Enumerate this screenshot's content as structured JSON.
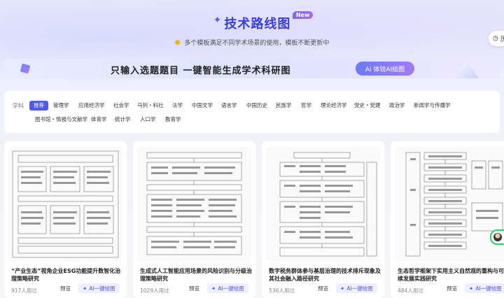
{
  "header": {
    "title": "技术路线图",
    "badge": "New",
    "subtitle": "多个模板满足不同学术场景的使用，模板不断更新中",
    "history_label": "历"
  },
  "banner": {
    "slogan": "只输入选题题目 一键智能生成学术科研图",
    "cta": "Ai 体验AI绘图"
  },
  "filters": {
    "label": "学科",
    "tags": [
      "推荐",
      "管理学",
      "应用经济学",
      "社会学",
      "马列・科社",
      "法学",
      "中国文学",
      "语言学",
      "中国历史",
      "民族学",
      "哲学",
      "理论经济学",
      "党史・党建",
      "政治学",
      "新闻学与传播学",
      "图书馆・情报与文献学",
      "体育学",
      "统计学",
      "人口学",
      "教育学"
    ],
    "active": "推荐"
  },
  "cards": [
    {
      "title": "“产业生态”视角企业ESG功能提升数智化治理策略研究",
      "users": "917人用过",
      "preview": "预览",
      "ai": "AI一键绘图"
    },
    {
      "title": "生成式人工智能应用场景的风险识别与分级治理策略研究",
      "users": "1029人用过",
      "preview": "预览",
      "ai": "AI一键绘图"
    },
    {
      "title": "数字税务群体参与基层治理的技术排斥现象及其社会融入路径研究",
      "users": "536人用过",
      "preview": "预览",
      "ai": "AI一键绘图"
    },
    {
      "title": "生态哲学框架下实用主义自然观的重构与可持续发展实践研究",
      "users": "484人用过",
      "preview": "预览",
      "ai": "AI一键绘图"
    }
  ],
  "colors": {
    "accent": "#4f58ef",
    "title": "#3a3fd6",
    "green": "#2ecc71"
  }
}
